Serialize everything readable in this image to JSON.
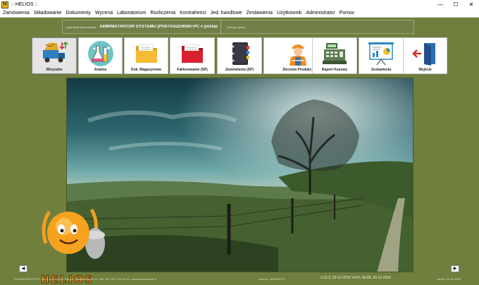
{
  "window": {
    "title": ":: HELIOS ::",
    "app_icon": "H",
    "controls": {
      "minimize": "—",
      "maximize": "☐",
      "close": "✕"
    }
  },
  "menu": [
    "Zamówienia",
    "Składowanie",
    "Dokumenty",
    "Wycena",
    "Laboratorium",
    "Rozliczenia",
    "Kontrahenci",
    "Jed. handlowe",
    "Zestawienia",
    "Użytkownik",
    "Administrator",
    "Pomoc"
  ],
  "info": {
    "user_label": "użytkownik (stanowisko):",
    "user_value": "ADMINISTRATOR SYSTEMU (POSTASZEWSKI-PC # postaszewski)",
    "object_label": "bieżący obiekt:",
    "object_value": ""
  },
  "toolbar": [
    {
      "label": "Wszystko",
      "icon": "truck-icon",
      "active": true
    },
    {
      "label": "Analiza",
      "icon": "flask-icon",
      "active": false
    },
    {
      "label": "Dok. Magazynowe",
      "icon": "folder-icon",
      "active": false
    },
    {
      "label": "Fakturowanie (SP)",
      "icon": "red-folder-icon",
      "active": false
    },
    {
      "label": "Zamówienia (SP)",
      "icon": "binder-icon",
      "active": false
    },
    {
      "label": "Zlecenia Produkc.",
      "icon": "worker-icon",
      "active": false
    },
    {
      "label": "Raport Kasowy",
      "icon": "cash-register-icon",
      "active": false
    },
    {
      "label": "Zestawienia",
      "icon": "presentation-icon",
      "active": false
    },
    {
      "label": "Wyjście",
      "icon": "exit-door-icon",
      "active": false
    }
  ],
  "nav": {
    "prev": "◀",
    "next": "▶"
  },
  "footer": {
    "company": "ELEWATORSOFT.PL Sp. z o.o., 64-920 Piła, ul. Sikorskiego 33 lok. 405, tel. (067) 212 45 04, www.elewatorsoft.pl",
    "license": "licencja: 3000004757",
    "version": "3.16.3, 23-12-2016 14:07, 06.88, 20-12-2016",
    "version_date": "wersja: 06-12-2016"
  },
  "logo": {
    "text": "HELIOS"
  },
  "colors": {
    "background": "#6e7f3e",
    "accent": "#f0a020"
  }
}
